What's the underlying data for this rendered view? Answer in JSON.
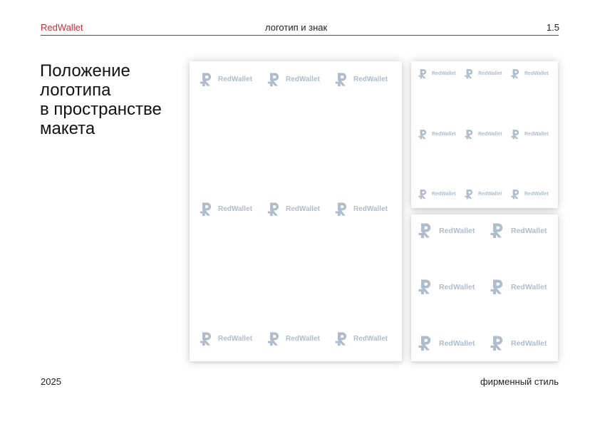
{
  "header": {
    "brand": "RedWallet",
    "section": "логотип и знак",
    "page_number": "1.5"
  },
  "title_lines": [
    "Положение",
    "логотипа",
    "в пространстве",
    "макета"
  ],
  "footer": {
    "year": "2025",
    "label": "фирменный стиль"
  },
  "logo": {
    "wordmark": "RedWallet",
    "icon": "redwallet-r-icon",
    "color": "#aebccb"
  },
  "colors": {
    "brand_red": "#d42a35"
  }
}
